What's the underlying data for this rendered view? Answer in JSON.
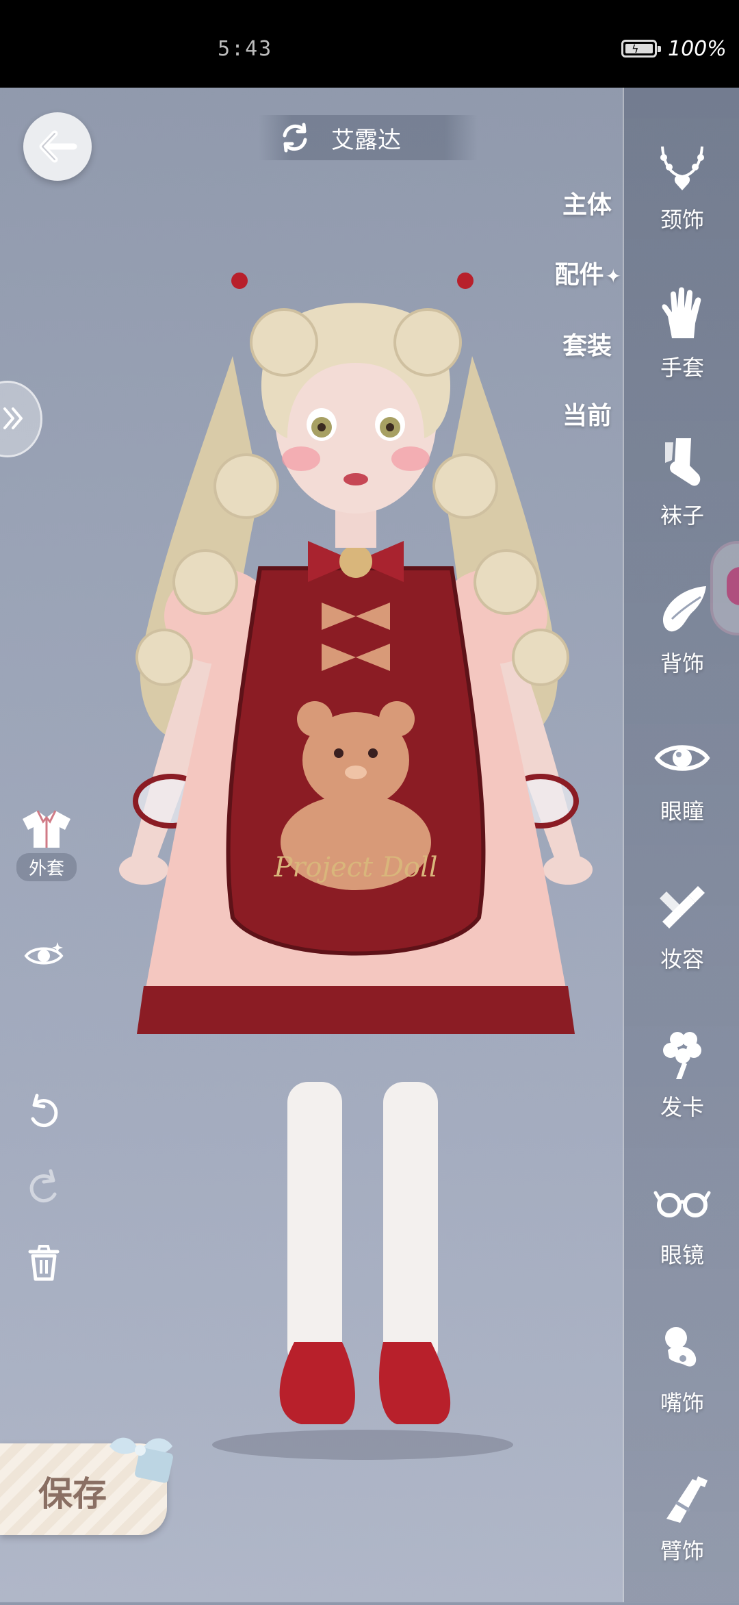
{
  "status_bar": {
    "time": "5:43",
    "battery_percent": "100%"
  },
  "header": {
    "character_name": "艾露达"
  },
  "category_tabs": [
    {
      "label": "主体",
      "active": false
    },
    {
      "label": "配件",
      "active": true
    },
    {
      "label": "套装",
      "active": false
    },
    {
      "label": "当前",
      "active": false
    }
  ],
  "sidebar": {
    "items": [
      {
        "label": "颈饰",
        "icon": "necklace-icon"
      },
      {
        "label": "手套",
        "icon": "glove-icon"
      },
      {
        "label": "袜子",
        "icon": "sock-icon"
      },
      {
        "label": "背饰",
        "icon": "wing-icon"
      },
      {
        "label": "眼瞳",
        "icon": "eye-icon"
      },
      {
        "label": "妆容",
        "icon": "makeup-icon"
      },
      {
        "label": "发卡",
        "icon": "hairpin-icon"
      },
      {
        "label": "眼镜",
        "icon": "glasses-icon"
      },
      {
        "label": "嘴饰",
        "icon": "pacifier-icon"
      },
      {
        "label": "臂饰",
        "icon": "arm-accessory-icon"
      }
    ]
  },
  "left_tools": {
    "coat_label": "外套"
  },
  "apron_text": "Project Doll",
  "save_label": "保存",
  "colors": {
    "dress_red": "#8b1c24",
    "dress_pink": "#f4c7c0",
    "hair": "#e8dcc0",
    "sock": "#f3f0ee"
  }
}
